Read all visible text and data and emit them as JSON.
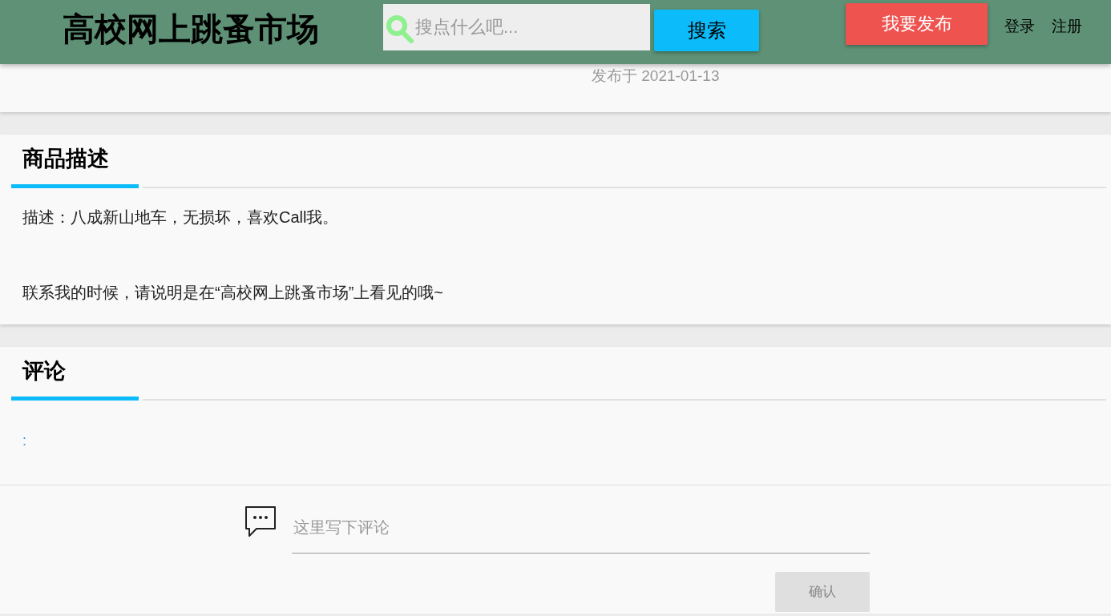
{
  "header": {
    "logo": "高校网上跳蚤市场",
    "search": {
      "placeholder": "搜点什么吧..."
    },
    "search_button": "搜索",
    "publish_button": "我要发布",
    "links": [
      "登录",
      "注册"
    ]
  },
  "item": {
    "published": "发布于 2021-01-13"
  },
  "description": {
    "title": "商品描述",
    "paragraphs": [
      "描述：八成新山地车，无损坏，喜欢Call我。",
      "联系我的时候，请说明是在“高校网上跳蚤市场”上看见的哦~"
    ]
  },
  "comments": {
    "title": "评论",
    "items": [
      {
        "text": ":"
      }
    ]
  },
  "comment_form": {
    "placeholder": "这里写下评论",
    "submit": "确认",
    "submit_disabled": true
  }
}
